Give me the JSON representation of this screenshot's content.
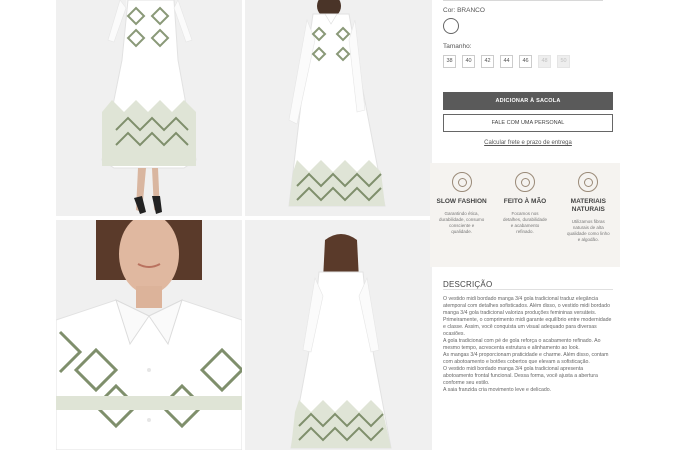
{
  "gallery": {
    "images": [
      {
        "name": "product-photo-front",
        "alt": ""
      },
      {
        "name": "product-photo-angled",
        "alt": ""
      },
      {
        "name": "product-photo-collar-detail",
        "alt": ""
      },
      {
        "name": "product-photo-back",
        "alt": ""
      }
    ]
  },
  "product": {
    "color_label": "Cor: BRANCO",
    "size_label": "Tamanho:",
    "sizes": [
      {
        "label": "38",
        "available": true
      },
      {
        "label": "40",
        "available": true
      },
      {
        "label": "42",
        "available": true
      },
      {
        "label": "44",
        "available": true
      },
      {
        "label": "46",
        "available": true
      },
      {
        "label": "48",
        "available": false
      },
      {
        "label": "50",
        "available": false
      }
    ],
    "add_to_bag": "ADICIONAR À SACOLA",
    "talk_personal": "FALE COM UMA PERSONAL",
    "shipping_link": "Calcular frete e prazo de entrega"
  },
  "features": [
    {
      "icon": "slow-fashion-icon",
      "title": "SLOW FASHION",
      "text": "Garantindo ética, durabilidade, consumo consciente e qualidade."
    },
    {
      "icon": "handmade-icon",
      "title": "FEITO À MÃO",
      "text": "Focamos nos detalhes, durabilidade e acabamento refinado."
    },
    {
      "icon": "natural-materials-icon",
      "title": "MATERIAIS NATURAIS",
      "text": "Utilizamos fibras naturais de alta qualidade como linho e algodão."
    }
  ],
  "description": {
    "title": "DESCRIÇÃO",
    "paragraphs": [
      "O vestido midi bordado manga 3/4 gola tradicional traduz elegância atemporal com detalhes sofisticados. Além disso, o vestido midi bordado manga 3/4 gola tradicional valoriza produções femininas versáteis.",
      "Primeiramente, o comprimento midi garante equilíbrio entre modernidade e classe. Assim, você conquista um visual adequado para diversas ocasiões.",
      "A gola tradicional com pé de gola reforça o acabamento refinado. Ao mesmo tempo, acrescenta estrutura e alinhamento ao look.",
      "As mangas 3/4 proporcionam praticidade e charme. Além disso, contam com abotoamento e botões cobertos que elevam a sofisticação.",
      "O vestido midi bordado manga 3/4 gola tradicional apresenta abotoamento frontal funcional. Dessa forma, você ajusta a abertura conforme seu estilo.",
      "A saia franzida cria movimento leve e delicado."
    ]
  },
  "colors": {
    "primary_button": "#5a5a5a",
    "feature_bg": "#f5f3f0",
    "embroidery": "#7f8f6c"
  }
}
